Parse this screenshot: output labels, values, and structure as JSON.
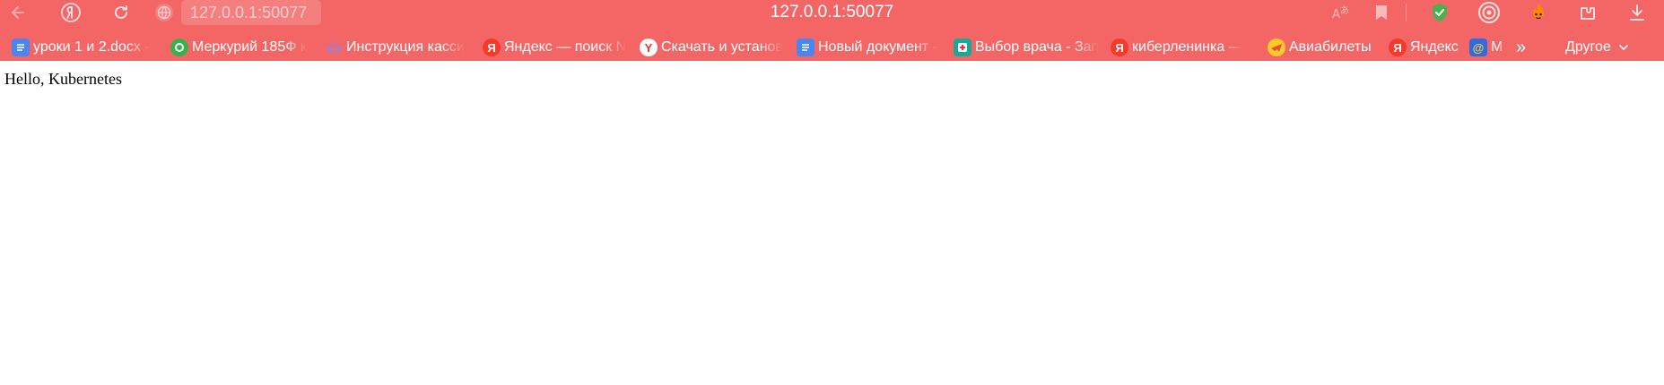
{
  "browser": {
    "address": "127.0.0.1:50077",
    "title": "127.0.0.1:50077",
    "accent_color": "#f46666",
    "toolbar_icons": [
      "back-arrow-icon",
      "yandex-logo-icon",
      "reload-icon",
      "site-info-icon"
    ],
    "right_icons": [
      "translate-icon",
      "bookmark-icon",
      "protect-shield-icon",
      "alice-icon",
      "extension-fire-icon",
      "extensions-icon",
      "download-icon"
    ]
  },
  "bookmarks": {
    "items": [
      {
        "label": "уроки 1 и 2.docx -",
        "icon": "docs-icon",
        "color": "#4a86f0"
      },
      {
        "label": "Меркурий 185Ф к",
        "icon": "green-circle-icon",
        "color": "#37b24d"
      },
      {
        "label": "Инструкция касси",
        "icon": "stack-icon",
        "color": "#9b7ede"
      },
      {
        "label": "Яндекс — поиск N",
        "icon": "yandex-icon",
        "color": "#f33a2c"
      },
      {
        "label": "Скачать и установ",
        "icon": "y-browser-icon",
        "color": "#ffffff"
      },
      {
        "label": "Новый документ -",
        "icon": "docs-icon",
        "color": "#4a86f0"
      },
      {
        "label": "Выбор врача - Зап",
        "icon": "medical-icon",
        "color": "#19a99b"
      },
      {
        "label": "киберленинка — ",
        "icon": "yandex-icon",
        "color": "#f33a2c"
      },
      {
        "label": "Авиабилеты",
        "icon": "plane-icon",
        "color": "#ffc928"
      },
      {
        "label": "Яндекс",
        "icon": "yandex-icon",
        "color": "#f33a2c"
      },
      {
        "label": "M",
        "icon": "mail-at-icon",
        "color": "#2f6be0"
      }
    ],
    "more_label": "»",
    "other_label": "Другое"
  },
  "page": {
    "text": "Hello, Kubernetes"
  }
}
